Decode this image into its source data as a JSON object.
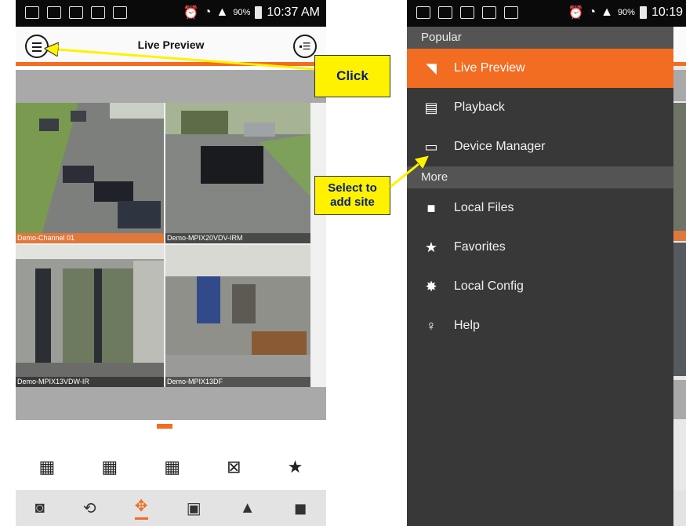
{
  "left_screen": {
    "status": {
      "battery": "90%",
      "time": "10:37 AM"
    },
    "header": {
      "title": "Live Preview"
    },
    "channels": [
      {
        "label": "Demo-Channel 01",
        "active": true
      },
      {
        "label": "Demo-MPIX20VDV-IRM",
        "active": false
      },
      {
        "label": "Demo-MPIX13VDW-IR",
        "active": false
      },
      {
        "label": "Demo-MPIX13DF",
        "active": false
      }
    ]
  },
  "callouts": {
    "click": "Click",
    "select_line1": "Select to",
    "select_line2": "add site"
  },
  "right_screen": {
    "status": {
      "battery": "90%",
      "time": "10:19"
    },
    "sections": {
      "popular": "Popular",
      "more": "More"
    },
    "menu": {
      "live_preview": "Live Preview",
      "playback": "Playback",
      "device_manager": "Device Manager",
      "local_files": "Local Files",
      "favorites": "Favorites",
      "local_config": "Local Config",
      "help": "Help"
    }
  },
  "colors": {
    "accent": "#f26c22",
    "callout": "#fff200",
    "drawer_bg": "#383838",
    "section_bg": "#545454"
  }
}
